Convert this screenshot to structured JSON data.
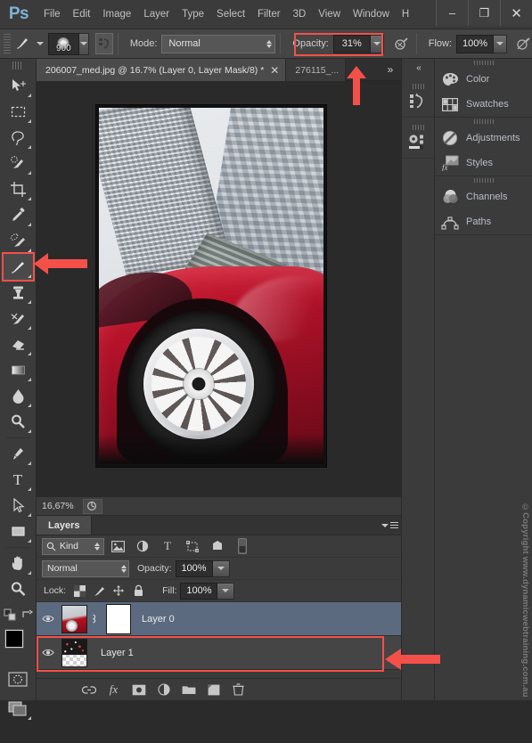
{
  "app": {
    "name": "Ps",
    "logo_text": "Ps"
  },
  "menubar": {
    "items": [
      "File",
      "Edit",
      "Image",
      "Layer",
      "Type",
      "Select",
      "Filter",
      "3D",
      "View",
      "Window",
      "H"
    ]
  },
  "window_controls": {
    "minimize": "–",
    "maximize": "❐",
    "close": "✕"
  },
  "options_bar": {
    "brush_size": "900",
    "mode_label": "Mode:",
    "mode_value": "Normal",
    "opacity_label": "Opacity:",
    "opacity_value": "31%",
    "flow_label": "Flow:",
    "flow_value": "100%",
    "highlight_color": "#f4504a"
  },
  "tabs": {
    "active": "206007_med.jpg @ 16.7% (Layer 0, Layer Mask/8) *",
    "close_glyph": "✕",
    "inactive": "276115_...",
    "overflow": "»"
  },
  "toolbar": {
    "tools": [
      {
        "name": "move-tool",
        "glyph": "move"
      },
      {
        "name": "marquee-tool",
        "glyph": "marquee"
      },
      {
        "name": "lasso-tool",
        "glyph": "lasso"
      },
      {
        "name": "quick-selection-tool",
        "glyph": "quickselect"
      },
      {
        "name": "crop-tool",
        "glyph": "crop"
      },
      {
        "name": "eyedropper-tool",
        "glyph": "eyedropper"
      },
      {
        "name": "healing-brush-tool",
        "glyph": "healing"
      },
      {
        "name": "brush-tool",
        "glyph": "brush",
        "active": true
      },
      {
        "name": "clone-stamp-tool",
        "glyph": "stamp"
      },
      {
        "name": "history-brush-tool",
        "glyph": "historybrush"
      },
      {
        "name": "eraser-tool",
        "glyph": "eraser"
      },
      {
        "name": "gradient-tool",
        "glyph": "gradient"
      },
      {
        "name": "blur-tool",
        "glyph": "blur"
      },
      {
        "name": "dodge-tool",
        "glyph": "dodge"
      },
      {
        "name": "pen-tool",
        "glyph": "pen"
      },
      {
        "name": "type-tool",
        "glyph": "T"
      },
      {
        "name": "path-selection-tool",
        "glyph": "pathselect"
      },
      {
        "name": "rectangle-tool",
        "glyph": "rectangle"
      },
      {
        "name": "hand-tool",
        "glyph": "hand"
      },
      {
        "name": "zoom-tool",
        "glyph": "zoom"
      }
    ],
    "foreground_color": "#000000",
    "background_color": "#ffffff"
  },
  "status_bar": {
    "zoom": "16,67%"
  },
  "layers_panel": {
    "tab_label": "Layers",
    "filter_kind": "Kind",
    "blend_mode": "Normal",
    "opacity_label": "Opacity:",
    "opacity_value": "100%",
    "lock_label": "Lock:",
    "fill_label": "Fill:",
    "fill_value": "100%",
    "layers": [
      {
        "name": "Layer 0",
        "selected": true,
        "has_mask": true,
        "linked": true
      },
      {
        "name": "Layer 1",
        "selected": false,
        "has_mask": false,
        "highlighted": true
      }
    ],
    "bottom_buttons": [
      "link-layers-button",
      "add-layer-style-button",
      "add-layer-mask-button",
      "new-adjustment-layer-button",
      "new-group-button",
      "new-layer-button",
      "delete-layer-button"
    ]
  },
  "right_dock": {
    "collapse_glyph": "«",
    "groups": [
      {
        "items": [
          {
            "label": "Color",
            "icon": "color-palette-icon"
          },
          {
            "label": "Swatches",
            "icon": "swatches-grid-icon"
          }
        ]
      },
      {
        "items": [
          {
            "label": "Adjustments",
            "icon": "adjustments-circle-icon"
          },
          {
            "label": "Styles",
            "icon": "styles-fx-icon"
          }
        ]
      },
      {
        "items": [
          {
            "label": "Channels",
            "icon": "channels-icon"
          },
          {
            "label": "Paths",
            "icon": "paths-icon"
          }
        ]
      }
    ],
    "strip_items": [
      "history-panel-icon",
      "properties-panel-icon"
    ]
  },
  "watermark": "©Copyright www.dynamicwebtraining.com.au",
  "annotations": {
    "color": "#f4504a",
    "arrows": [
      "opacity-arrow",
      "brush-tool-arrow",
      "layer1-arrow"
    ]
  }
}
